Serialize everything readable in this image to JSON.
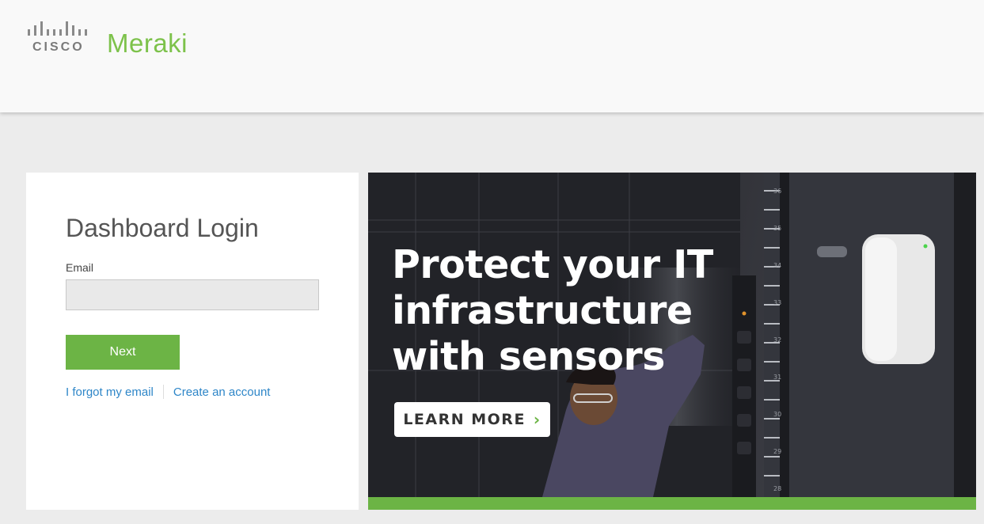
{
  "header": {
    "cisco_logo_text": "CISCO",
    "meraki_logo_text": "Meraki"
  },
  "login": {
    "title": "Dashboard Login",
    "email_label": "Email",
    "email_value": "",
    "email_placeholder": "",
    "next_label": "Next",
    "forgot_email_link": "I forgot my email",
    "create_account_link": "Create an account"
  },
  "banner": {
    "headline_lines": [
      "Protect your IT",
      "infrastructure",
      "with sensors"
    ],
    "cta_label": "LEARN MORE",
    "cta_icon": "chevron-right-icon",
    "rack_numbers": [
      "36",
      "35",
      "34",
      "33",
      "32",
      "31",
      "30",
      "29",
      "28"
    ]
  },
  "colors": {
    "brand_green": "#6cb445",
    "link_blue": "#2e86c8",
    "meraki_green": "#7dc24b"
  }
}
